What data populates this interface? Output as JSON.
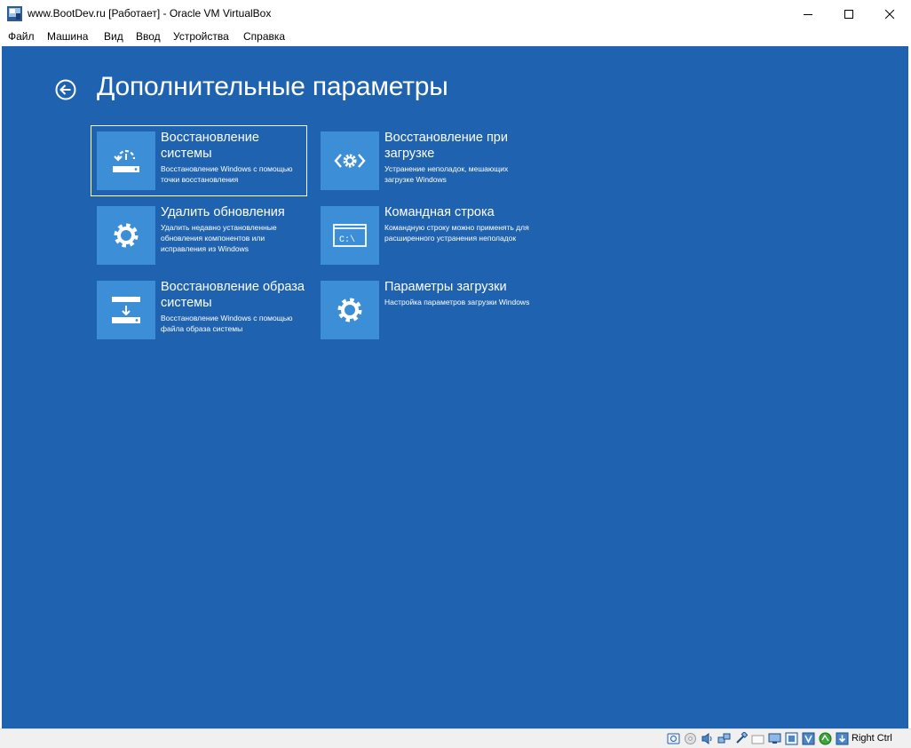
{
  "window": {
    "title": "www.BootDev.ru [Работает] - Oracle VM VirtualBox",
    "minimize_icon": "minimize-icon",
    "maximize_icon": "maximize-icon",
    "close_icon": "close-icon"
  },
  "menu": {
    "items": [
      "Файл",
      "Машина",
      "Вид",
      "Ввод",
      "Устройства",
      "Справка"
    ]
  },
  "screen": {
    "background": "#1f63b0",
    "tile_icon_bg": "#3c8fd6",
    "back_icon": "back-arrow-icon",
    "title": "Дополнительные параметры",
    "tiles": [
      {
        "icon": "system-restore-icon",
        "title": "Восстановление системы",
        "desc": "Восстановление Windows с помощью точки восстановления",
        "selected": true
      },
      {
        "icon": "startup-repair-icon",
        "title": "Восстановление при загрузке",
        "desc": "Устранение неполадок, мешающих загрузке Windows",
        "selected": false
      },
      {
        "icon": "gear-icon",
        "title": "Удалить обновления",
        "desc": "Удалить недавно установленные обновления компонентов или исправления из Windows",
        "selected": false
      },
      {
        "icon": "command-prompt-icon",
        "title": "Командная строка",
        "desc": "Командную строку можно применять для расширенного устранения неполадок",
        "selected": false
      },
      {
        "icon": "system-image-recovery-icon",
        "title": "Восстановление образа системы",
        "desc": "Восстановление Windows с помощью файла образа системы",
        "selected": false
      },
      {
        "icon": "gear-icon",
        "title": "Параметры загрузки",
        "desc": "Настройка параметров загрузки Windows",
        "selected": false
      }
    ],
    "command_prompt_text": "C:\\"
  },
  "statusbar": {
    "host_key": "Right Ctrl",
    "icons": [
      "hard-disk-icon",
      "optical-drive-icon",
      "audio-icon",
      "network-icon",
      "usb-icon",
      "shared-folders-icon",
      "display-icon",
      "video-capture-icon",
      "virtualization-icon",
      "mouse-integration-icon",
      "keyboard-capture-icon"
    ]
  }
}
